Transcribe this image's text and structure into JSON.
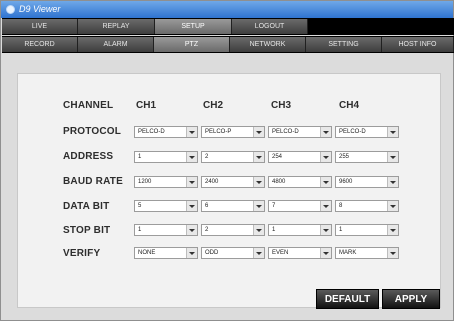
{
  "window": {
    "title": "D9 Viewer"
  },
  "top_tabs": [
    "LIVE",
    "REPLAY",
    "SETUP",
    "LOGOUT"
  ],
  "sub_tabs": [
    "RECORD",
    "ALARM",
    "PTZ",
    "NETWORK",
    "SETTING",
    "HOST INFO"
  ],
  "ptz": {
    "labels": {
      "channel": "CHANNEL",
      "protocol": "PROTOCOL",
      "address": "ADDRESS",
      "baud_rate": "BAUD RATE",
      "data_bit": "DATA BIT",
      "stop_bit": "STOP BIT",
      "verify": "VERIFY"
    },
    "channels": [
      {
        "name": "CH1",
        "protocol": "PELCO-D",
        "address": "1",
        "baud_rate": "1200",
        "data_bit": "5",
        "stop_bit": "1",
        "verify": "NONE"
      },
      {
        "name": "CH2",
        "protocol": "PELCO-P",
        "address": "2",
        "baud_rate": "2400",
        "data_bit": "6",
        "stop_bit": "2",
        "verify": "ODD"
      },
      {
        "name": "CH3",
        "protocol": "PELCO-D",
        "address": "254",
        "baud_rate": "4800",
        "data_bit": "7",
        "stop_bit": "1",
        "verify": "EVEN"
      },
      {
        "name": "CH4",
        "protocol": "PELCO-D",
        "address": "255",
        "baud_rate": "9600",
        "data_bit": "8",
        "stop_bit": "1",
        "verify": "MARK"
      }
    ]
  },
  "buttons": {
    "default": "DEFAULT",
    "apply": "APPLY"
  }
}
